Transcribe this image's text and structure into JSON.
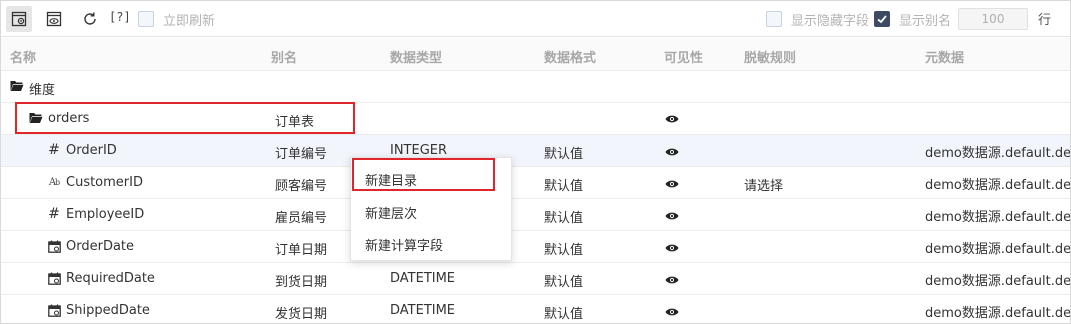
{
  "toolbar": {
    "help_label": "[?]",
    "refresh_now_label": "立即刷新",
    "show_hidden_label": "显示隐藏字段",
    "show_alias_label": "显示别名",
    "row_count_value": "100",
    "row_unit": "行",
    "show_alias_checked": true
  },
  "columns": {
    "name": "名称",
    "alias": "别名",
    "data_type": "数据类型",
    "data_format": "数据格式",
    "visibility": "可见性",
    "masking": "脱敏规则",
    "metadata": "元数据"
  },
  "tree": {
    "root_label": "维度",
    "folder": {
      "name": "orders",
      "alias": "订单表"
    }
  },
  "rows": [
    {
      "type_icon": "hash-icon",
      "name": "OrderID",
      "alias": "订单编号",
      "data_type": "INTEGER",
      "format": "默认值",
      "masking": "",
      "metadata": "demo数据源.default.default"
    },
    {
      "type_icon": "text-icon",
      "name": "CustomerID",
      "alias": "顾客编号",
      "data_type": "",
      "format": "默认值",
      "masking": "请选择",
      "metadata": "demo数据源.default.default"
    },
    {
      "type_icon": "hash-icon",
      "name": "EmployeeID",
      "alias": "雇员编号",
      "data_type": "",
      "format": "默认值",
      "masking": "",
      "metadata": "demo数据源.default.default"
    },
    {
      "type_icon": "calendar-icon",
      "name": "OrderDate",
      "alias": "订单日期",
      "data_type": "",
      "format": "默认值",
      "masking": "",
      "metadata": "demo数据源.default.default"
    },
    {
      "type_icon": "calendar-icon",
      "name": "RequiredDate",
      "alias": "到货日期",
      "data_type": "DATETIME",
      "format": "默认值",
      "masking": "",
      "metadata": "demo数据源.default.default"
    },
    {
      "type_icon": "calendar-icon",
      "name": "ShippedDate",
      "alias": "发货日期",
      "data_type": "DATETIME",
      "format": "默认值",
      "masking": "",
      "metadata": "demo数据源.default.default"
    }
  ],
  "context_menu": {
    "items": [
      "新建目录",
      "新建层次",
      "新建计算字段"
    ]
  },
  "colors": {
    "highlight_border": "#e0262b",
    "hover_row": "#f2f6fc",
    "header_text": "#a8a8a8",
    "checkbox_checked": "#3e4a63"
  }
}
